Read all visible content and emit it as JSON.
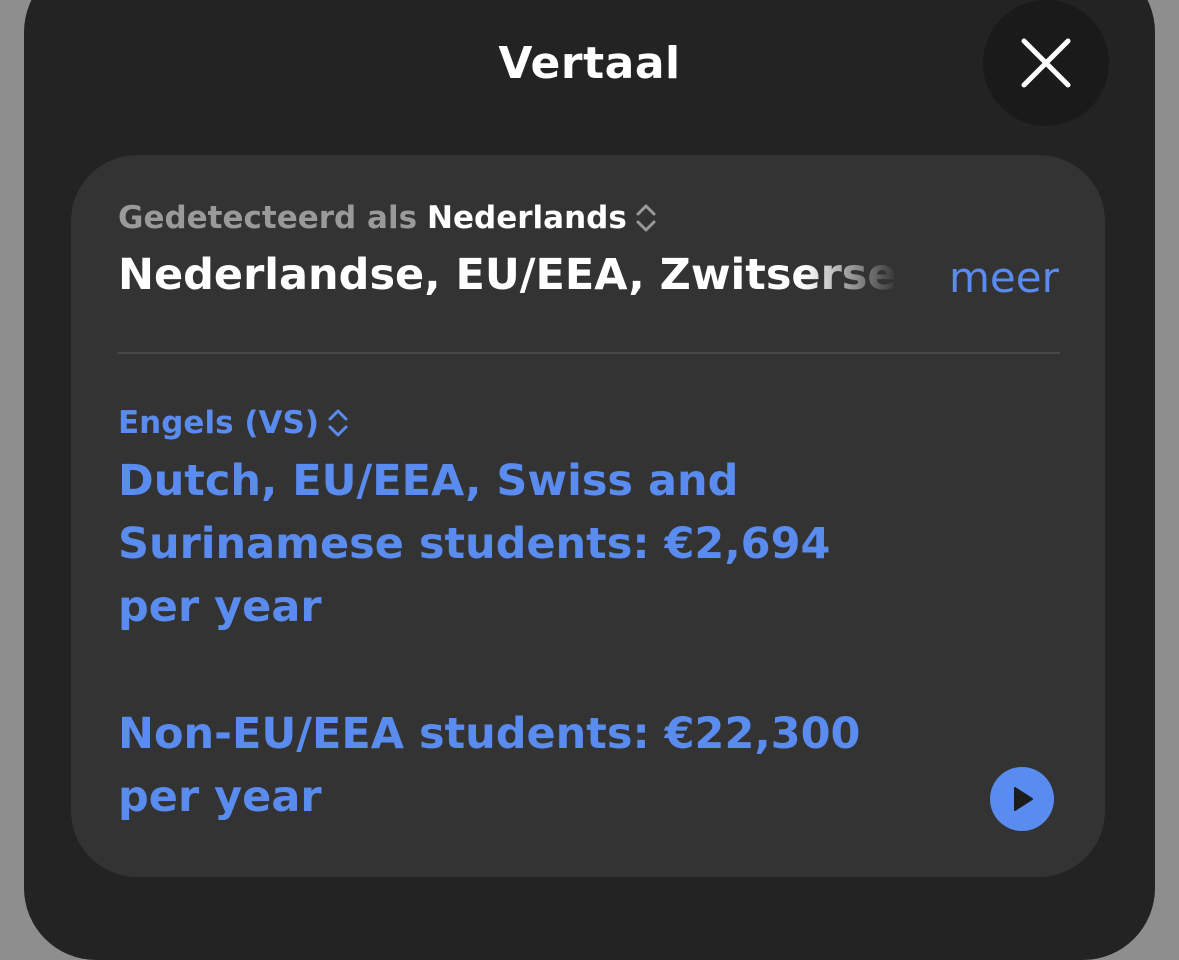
{
  "header": {
    "title": "Vertaal",
    "close_icon": "close-icon"
  },
  "source": {
    "detected_label": "Gedetecteerd als",
    "language": "Nederlands",
    "text": "Nederlandse, EU/EEA, Zwitserse e",
    "more_label": "meer"
  },
  "target": {
    "language": "Engels (VS)",
    "paragraphs": [
      "Dutch, EU/EEA, Swiss and Surinamese students: €2,694 per year",
      "Non-EU/EEA students: €22,300 per year"
    ],
    "play_icon": "play-icon"
  },
  "colors": {
    "accent": "#5a8cf0",
    "sheet_background": "#232323",
    "card_background": "#333333",
    "page_backdrop": "#8e8e8e"
  }
}
